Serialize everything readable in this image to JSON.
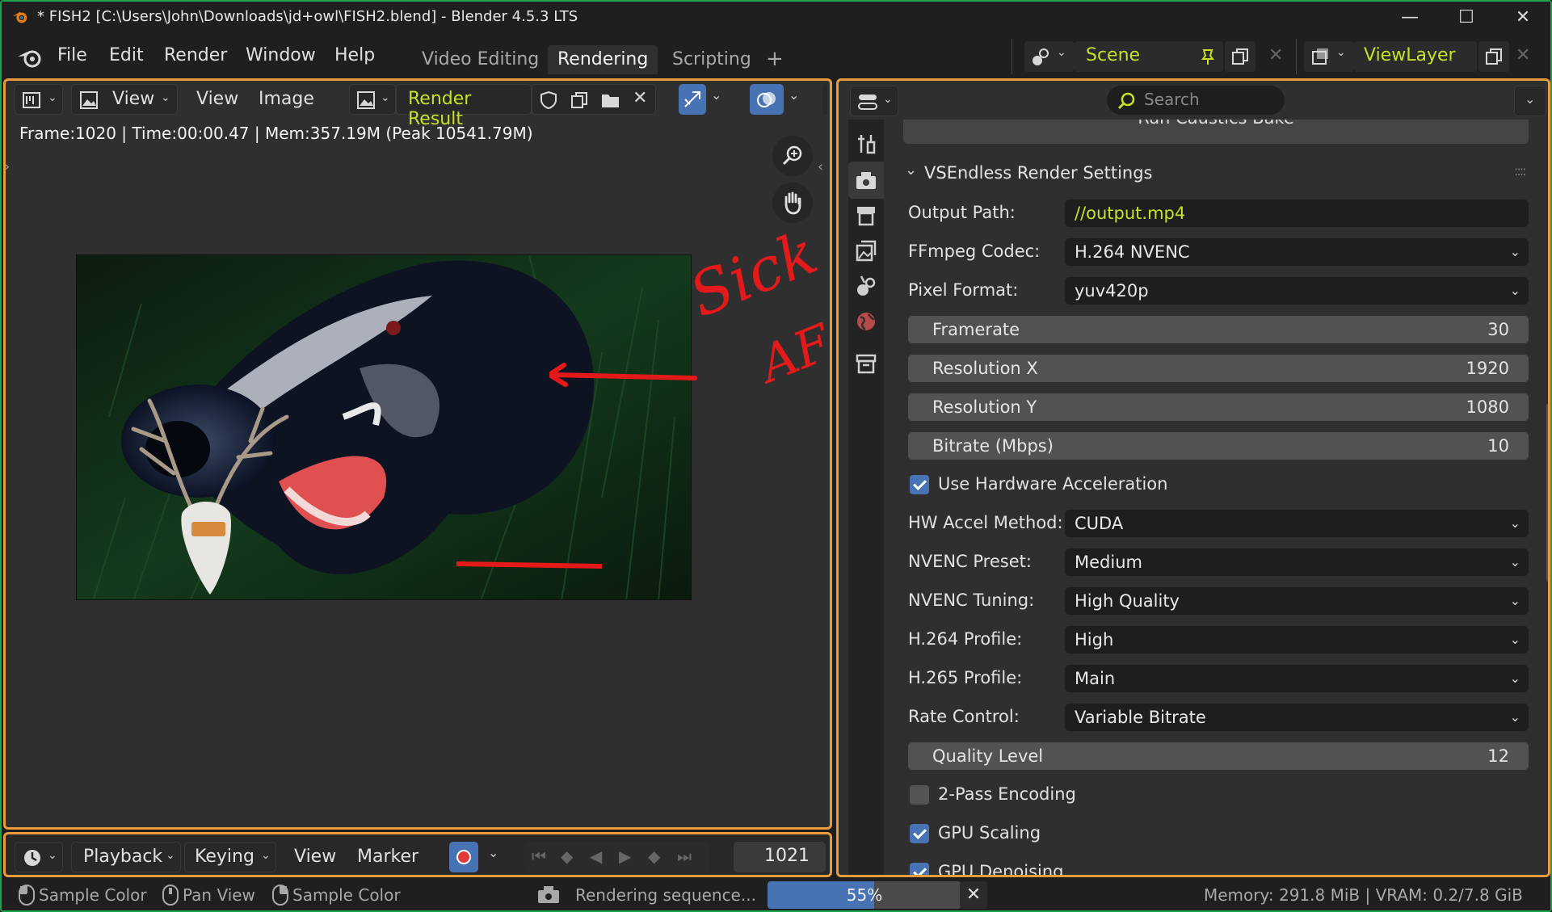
{
  "window": {
    "title": "* FISH2 [C:\\Users\\John\\Downloads\\jd+owl\\FISH2.blend] - Blender 4.5.3 LTS",
    "minimize": "—",
    "maximize": "☐",
    "close": "✕"
  },
  "menu": {
    "file": "File",
    "edit": "Edit",
    "render": "Render",
    "window": "Window",
    "help": "Help"
  },
  "workspaces": {
    "tabs": [
      "Video Editing",
      "Rendering",
      "Scripting"
    ],
    "active": "Rendering",
    "add": "+"
  },
  "scene": {
    "name": "Scene"
  },
  "view_layer": {
    "name": "ViewLayer"
  },
  "image_editor": {
    "view_menu_1": "View",
    "view_menu_2": "View",
    "image_menu": "Image",
    "image_name": "Render Result",
    "info": "Frame:1020 | Time:00:00.47 | Mem:357.19M (Peak 10541.79M)",
    "annotation_line1": "Sick",
    "annotation_line2": "AF"
  },
  "properties": {
    "search_placeholder": "Search",
    "cut_off_button": "Run Caustics Bake",
    "panel_title": "VSEndless Render Settings",
    "output_path_label": "Output Path:",
    "output_path_value": "//output.mp4",
    "ffmpeg_codec_label": "FFmpeg Codec:",
    "ffmpeg_codec_value": "H.264 NVENC",
    "pixel_format_label": "Pixel Format:",
    "pixel_format_value": "yuv420p",
    "framerate_label": "Framerate",
    "framerate_value": "30",
    "res_x_label": "Resolution X",
    "res_x_value": "1920",
    "res_y_label": "Resolution Y",
    "res_y_value": "1080",
    "bitrate_label": "Bitrate (Mbps)",
    "bitrate_value": "10",
    "hw_accel_label": "Use Hardware Acceleration",
    "hw_accel_checked": true,
    "hw_method_label": "HW Accel Method:",
    "hw_method_value": "CUDA",
    "nvenc_preset_label": "NVENC Preset:",
    "nvenc_preset_value": "Medium",
    "nvenc_tuning_label": "NVENC Tuning:",
    "nvenc_tuning_value": "High Quality",
    "h264_profile_label": "H.264 Profile:",
    "h264_profile_value": "High",
    "h265_profile_label": "H.265 Profile:",
    "h265_profile_value": "Main",
    "rate_control_label": "Rate Control:",
    "rate_control_value": "Variable Bitrate",
    "quality_label": "Quality Level",
    "quality_value": "12",
    "two_pass_label": "2-Pass Encoding",
    "two_pass_checked": false,
    "gpu_scaling_label": "GPU Scaling",
    "gpu_scaling_checked": true,
    "gpu_denoising_label": "GPU Denoising",
    "gpu_denoising_checked": true
  },
  "timeline": {
    "playback": "Playback",
    "keying": "Keying",
    "view": "View",
    "marker": "Marker",
    "current_frame": "1021"
  },
  "statusbar": {
    "hint1": "Sample Color",
    "hint2": "Pan View",
    "hint3": "Sample Color",
    "job": "Rendering sequence...",
    "progress_label": "55%",
    "progress_fraction": 0.55,
    "memory": "Memory: 291.8 MiB | VRAM: 0.2/7.8 GiB"
  },
  "colors": {
    "accent_orange": "#e89a3c",
    "window_border": "#19a34a",
    "active_yellow": "#c8e028",
    "checkbox_blue": "#4772b3",
    "progress_blue": "#4772b3"
  }
}
